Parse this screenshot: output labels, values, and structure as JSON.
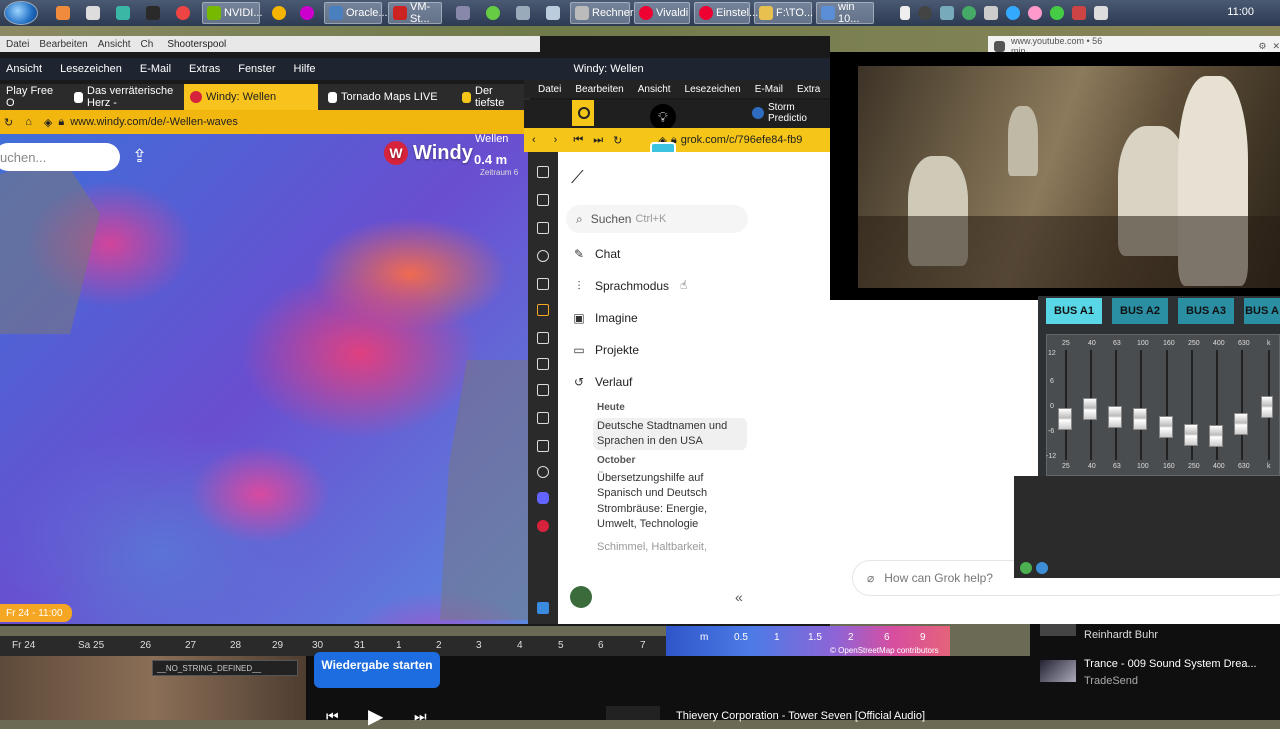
{
  "taskbar": {
    "items": [
      {
        "label": "",
        "icon": "folder-icon"
      },
      {
        "label": "",
        "icon": "edit-icon"
      },
      {
        "label": "",
        "icon": "terminal-icon"
      },
      {
        "label": "",
        "icon": "chart-icon"
      },
      {
        "label": "",
        "icon": "chrome-icon"
      },
      {
        "label": "NVIDI...",
        "icon": "nvidia-icon"
      },
      {
        "label": "",
        "icon": "chrome-icon"
      },
      {
        "label": "Oracle...",
        "icon": "virtualbox-icon"
      },
      {
        "label": "VM-St...",
        "icon": "vm-icon"
      },
      {
        "label": "",
        "icon": "network-icon"
      },
      {
        "label": "",
        "icon": "globe-icon"
      },
      {
        "label": "Rechner",
        "icon": "calculator-icon"
      },
      {
        "label": "Vivaldi",
        "icon": "vivaldi-icon"
      },
      {
        "label": "Einstel...",
        "icon": "vivaldi-icon"
      },
      {
        "label": "F:\\TO...",
        "icon": "folder-icon"
      },
      {
        "label": "win 10...",
        "icon": "win-icon"
      }
    ],
    "clock": "11:00"
  },
  "windy": {
    "menu_top": [
      "Datei",
      "Bearbeiten",
      "Ansicht",
      "Ch"
    ],
    "shooterspool": "Shooterspool",
    "menu": [
      "Ansicht",
      "Lesezeichen",
      "E-Mail",
      "Extras",
      "Fenster",
      "Hilfe"
    ],
    "tabs": [
      {
        "label": "Play Free O"
      },
      {
        "label": "Das verräterische Herz -"
      },
      {
        "label": "Windy: Wellen"
      },
      {
        "label": "Tornado Maps LIVE"
      },
      {
        "label": "Der tiefste"
      }
    ],
    "url": "www.windy.com/de/-Wellen-waves",
    "search_placeholder": "uchen...",
    "logo": "Windy",
    "layer_label": "Wellen",
    "wave_value": "0.4 m",
    "zeitraum": "Zeitraum 6",
    "date_badge": "Fr 24 - 11:00",
    "timeline_days": [
      "Fr 24",
      "Sa 25",
      "26",
      "27",
      "28",
      "29",
      "30",
      "31",
      "1",
      "2",
      "3",
      "4",
      "5",
      "6",
      "7"
    ],
    "legend": [
      "m",
      "0.5",
      "1",
      "1.5",
      "2",
      "6",
      "9"
    ],
    "osm": "© OpenStreetMap contributors"
  },
  "grok": {
    "window_title": "Windy: Wellen",
    "menu": [
      "Datei",
      "Bearbeiten",
      "Ansicht",
      "Lesezeichen",
      "E-Mail",
      "Extra"
    ],
    "storm_tab": "Storm Predictio",
    "url": "grok.com/c/796efe84-fb9",
    "search": "Suchen",
    "search_hint": "Ctrl+K",
    "nav": [
      "Chat",
      "Sprachmodus",
      "Imagine",
      "Projekte",
      "Verlauf"
    ],
    "history_today": "Heute",
    "history_today_items": [
      "Deutsche Stadtnamen und Sprachen in den USA"
    ],
    "history_october": "October",
    "history_october_items": [
      "Übersetzungshilfe auf Spanisch und Deutsch",
      "Strombräuse: Energie, Umwelt, Technologie",
      "Schimmel, Haltbarkeit,"
    ],
    "input_placeholder": "How can Grok help?",
    "collapse": "«"
  },
  "youtube": {
    "bar": "www.youtube.com • 56 min"
  },
  "mixer": {
    "buses": [
      "BUS A1",
      "BUS A2",
      "BUS A3",
      "BUS A"
    ],
    "freqs": [
      "25",
      "40",
      "63",
      "100",
      "160",
      "250",
      "400",
      "630",
      "k"
    ],
    "levels_db": [
      "12",
      "6",
      "0",
      "-6",
      "-12"
    ]
  },
  "player": {
    "tooltip": "Wiedergabe starten",
    "no_string": "__NO_STRING_DEFINED__",
    "now_playing": "Thievery Corporation - Tower Seven [Official Audio]",
    "side": [
      {
        "title": "Reinhardt Buhr",
        "sub": ""
      },
      {
        "title": "Trance - 009 Sound System Drea...",
        "sub": "TradeSend"
      }
    ]
  }
}
